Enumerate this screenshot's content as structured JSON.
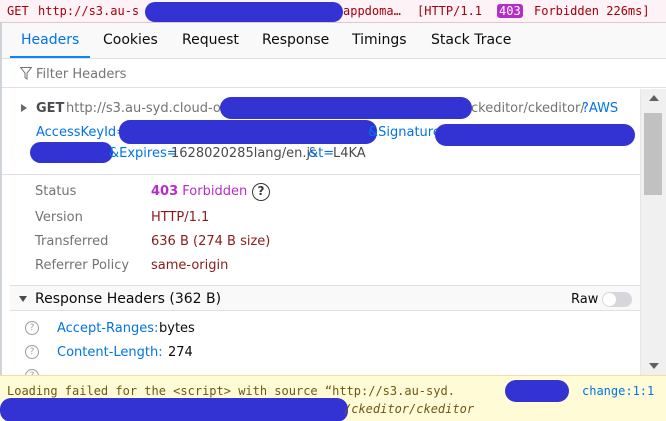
{
  "request_line": {
    "method": "GET",
    "url_start": "http://s3.au-s",
    "url_mid": "appdoma…",
    "protocol": "[HTTP/1.1",
    "status_code": "403",
    "status_rest": "Forbidden 226ms]"
  },
  "tabs": [
    {
      "label": "Headers"
    },
    {
      "label": "Cookies"
    },
    {
      "label": "Request"
    },
    {
      "label": "Response"
    },
    {
      "label": "Timings"
    },
    {
      "label": "Stack Trace"
    }
  ],
  "filter": {
    "placeholder": "Filter Headers"
  },
  "url_block": {
    "method": "GET",
    "host": "http://s3.au-syd.cloud-ob",
    "path_end": "ckeditor/ckeditor/",
    "query_q": "?AWS",
    "access_key": "AccessKeyId=",
    "signature": "&Signature",
    "expires_key": "&Expires=",
    "expires_val": "1628020285lang/en.js",
    "t_key": "&t=",
    "t_val": "L4KA"
  },
  "summary": {
    "status_label": "Status",
    "status_code": "403",
    "status_text": "Forbidden",
    "version_label": "Version",
    "version_value": "HTTP/1.1",
    "transferred_label": "Transferred",
    "transferred_value": "636 B (274 B size)",
    "referrer_label": "Referrer Policy",
    "referrer_value": "same-origin"
  },
  "response_headers": {
    "title": "Response Headers (362 B)",
    "raw_label": "Raw",
    "raw_on": false,
    "rows": [
      {
        "name": "Accept-Ranges:",
        "value": "bytes"
      },
      {
        "name": "Content-Length:",
        "value": "274"
      }
    ]
  },
  "console": {
    "message": "Loading failed for the <script> with source “http://s3.au-syd.",
    "location": "change:1:1",
    "line2": "/ckeditor/ckeditor"
  },
  "colors": {
    "redaction": "#3333d4",
    "status_purple": "#b52dc8",
    "link_blue": "#0074e8"
  }
}
